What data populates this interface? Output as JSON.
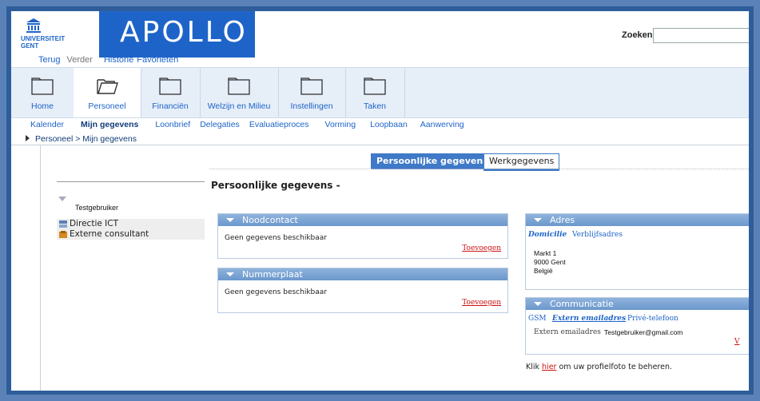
{
  "header": {
    "logo_text": "UNIVERSITEIT GENT",
    "app_title": "APOLLO",
    "search_label": "Zoeken:",
    "search_value": ""
  },
  "history": {
    "back": "Terug",
    "forward": "Verder",
    "history": "Historie",
    "favorites": "Favorieten"
  },
  "toolbar": [
    {
      "label": "Home"
    },
    {
      "label": "Personeel"
    },
    {
      "label": "Financiën"
    },
    {
      "label": "Welzijn en Milieu"
    },
    {
      "label": "Instellingen"
    },
    {
      "label": "Taken"
    }
  ],
  "subtabs": [
    {
      "label": "Kalender"
    },
    {
      "label": "Mijn gegevens"
    },
    {
      "label": "Loonbrief"
    },
    {
      "label": "Delegaties"
    },
    {
      "label": "Evaluatieproces"
    },
    {
      "label": "Vorming"
    },
    {
      "label": "Loopbaan"
    },
    {
      "label": "Aanwerving"
    }
  ],
  "breadcrumb": "Personeel  >  Mijn gegevens",
  "panel_tabs": {
    "active": "Persoonlijke gegevens",
    "other": "Werkgegevens"
  },
  "page_title": "Persoonlijke gegevens -",
  "left": {
    "user": "Testgebruiker",
    "org_units": [
      "Directie ICT",
      "Externe consultant"
    ]
  },
  "noodcontact": {
    "title": "Noodcontact",
    "empty": "Geen gegevens beschikbaar",
    "add": "Toevoegen"
  },
  "nummerplaat": {
    "title": "Nummerplaat",
    "empty": "Geen gegevens beschikbaar",
    "add": "Toevoegen"
  },
  "adres": {
    "title": "Adres",
    "tab_domicilie": "Domicilie",
    "tab_verblijf": "Verblijfsadres",
    "line1": "Markt 1",
    "line2": "9000 Gent",
    "line3": "België"
  },
  "communicatie": {
    "title": "Communicatie",
    "tab_gsm": "GSM",
    "tab_extern": "Extern emailadres",
    "tab_prive": "Privé-telefoon",
    "field_label": "Extern emailadres",
    "field_value": "Testgebruiker@gmail.com",
    "edit_cut": "V"
  },
  "footer": {
    "pre": "Klik ",
    "link": "hier",
    "post": " om uw profielfoto te beheren."
  },
  "colors": {
    "brand_blue": "#1e64c8",
    "frame": "#5b82b8",
    "link_red": "#cc1111"
  }
}
